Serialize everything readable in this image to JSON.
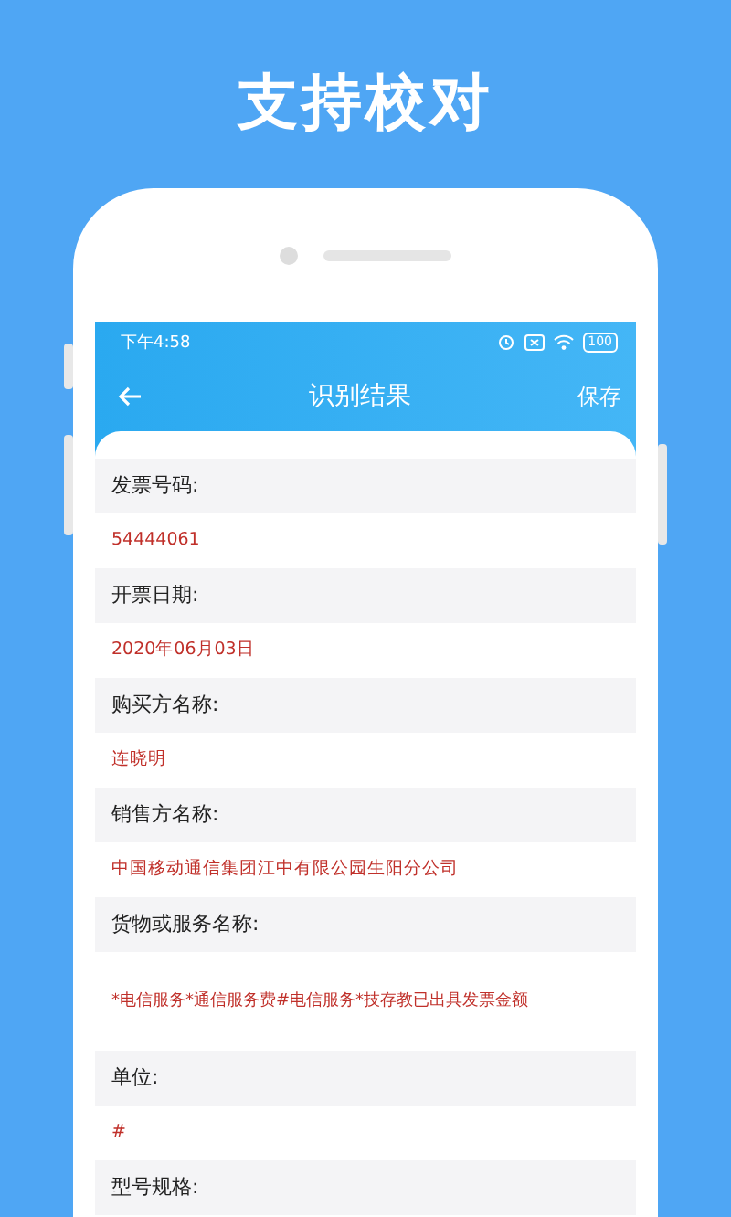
{
  "headline": "支持校对",
  "status_bar": {
    "time": "下午4:58",
    "battery": "100"
  },
  "nav": {
    "title": "识别结果",
    "action": "保存"
  },
  "fields": [
    {
      "label": "发票号码:",
      "value": "54444061",
      "tall": false
    },
    {
      "label": "开票日期:",
      "value": "2020年06月03日",
      "tall": false
    },
    {
      "label": "购买方名称:",
      "value": "连晓明",
      "tall": false
    },
    {
      "label": "销售方名称:",
      "value": "中国移动通信集团江中有限公园生阳分公司",
      "tall": false
    },
    {
      "label": "货物或服务名称:",
      "value": "*电信服务*通信服务费#电信服务*技存教已出具发票金额",
      "tall": true
    },
    {
      "label": "单位:",
      "value": "#",
      "tall": false
    },
    {
      "label": "型号规格:"
    }
  ]
}
